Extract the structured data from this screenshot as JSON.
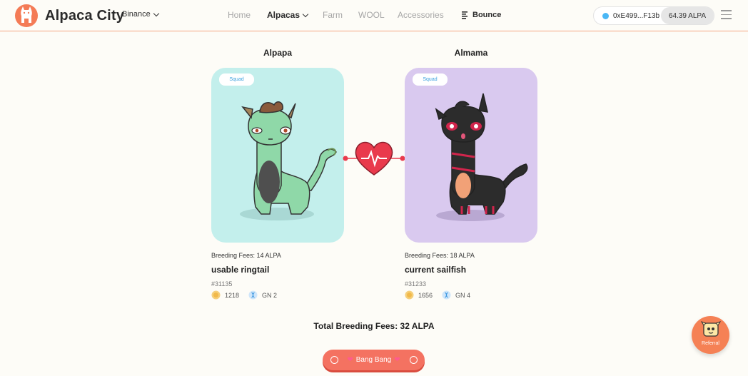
{
  "header": {
    "logo_text": "Alpaca City",
    "network": "Binance",
    "nav": [
      {
        "label": "Home"
      },
      {
        "label": "Alpacas"
      },
      {
        "label": "Farm"
      },
      {
        "label": "WOOL"
      },
      {
        "label": "Accessories"
      },
      {
        "label": "Bounce"
      }
    ],
    "wallet_address": "0xE499...F13b",
    "wallet_balance": "64.39 ALPA"
  },
  "left": {
    "title": "Alpapa",
    "badge": "Squad",
    "fees": "Breeding Fees: 14 ALPA",
    "name": "usable ringtail",
    "id": "#31135",
    "energy": "1218",
    "gen": "GN 2"
  },
  "right": {
    "title": "Almama",
    "badge": "Squad",
    "fees": "Breeding Fees: 18 ALPA",
    "name": "current sailfish",
    "id": "#31233",
    "energy": "1656",
    "gen": "GN 4"
  },
  "total": "Total Breeding Fees: 32 ALPA",
  "action_button": "Bang Bang",
  "referral": "Referral",
  "colors": {
    "accent": "#f47261",
    "left_card": "#c3efec",
    "right_card": "#d9c9ef",
    "heart": "#e93a4c"
  }
}
